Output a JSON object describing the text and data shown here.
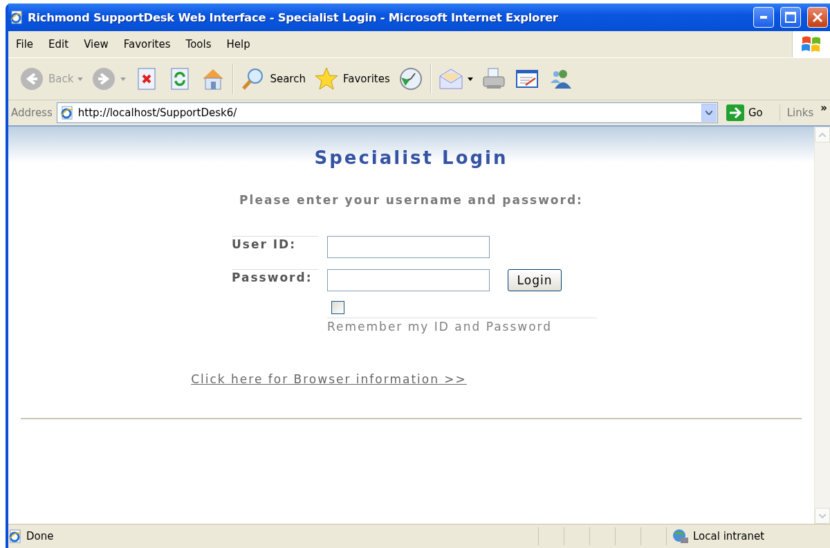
{
  "window": {
    "title": "Richmond SupportDesk Web Interface - Specialist Login - Microsoft Internet Explorer"
  },
  "menu": [
    "File",
    "Edit",
    "View",
    "Favorites",
    "Tools",
    "Help"
  ],
  "toolbar": [
    {
      "kind": "back",
      "label": "Back",
      "disabled": true,
      "dropdown": true
    },
    {
      "kind": "forward",
      "disabled": true,
      "dropdown": true
    },
    {
      "kind": "stop",
      "disabled": false,
      "dropdown": false
    },
    {
      "kind": "refresh",
      "disabled": false,
      "dropdown": false
    },
    {
      "kind": "home",
      "disabled": false,
      "dropdown": false
    },
    {
      "kind": "separator"
    },
    {
      "kind": "search",
      "label": "Search",
      "disabled": false,
      "dropdown": false
    },
    {
      "kind": "favorites",
      "label": "Favorites",
      "disabled": false,
      "dropdown": false
    },
    {
      "kind": "history",
      "disabled": false,
      "dropdown": false
    },
    {
      "kind": "separator"
    },
    {
      "kind": "mail",
      "disabled": false,
      "dropdown": true
    },
    {
      "kind": "print",
      "disabled": false,
      "dropdown": false
    },
    {
      "kind": "edit",
      "disabled": false,
      "dropdown": false
    },
    {
      "kind": "messenger",
      "disabled": false,
      "dropdown": false
    }
  ],
  "address_bar": {
    "label": "Address",
    "url": "http://localhost/SupportDesk6/",
    "go": "Go",
    "links": "Links",
    "more": "»"
  },
  "page": {
    "heading": "Specialist Login",
    "prompt": "Please enter your username and password:",
    "fields": [
      {
        "label": "User ID:"
      },
      {
        "label": "Password:"
      }
    ],
    "login_button": "Login",
    "remember": {
      "checked": false,
      "label": "Remember my ID and Password"
    },
    "link": "Click here for Browser information >>"
  },
  "status_bar": {
    "text": "Done",
    "zone": "Local intranet"
  }
}
